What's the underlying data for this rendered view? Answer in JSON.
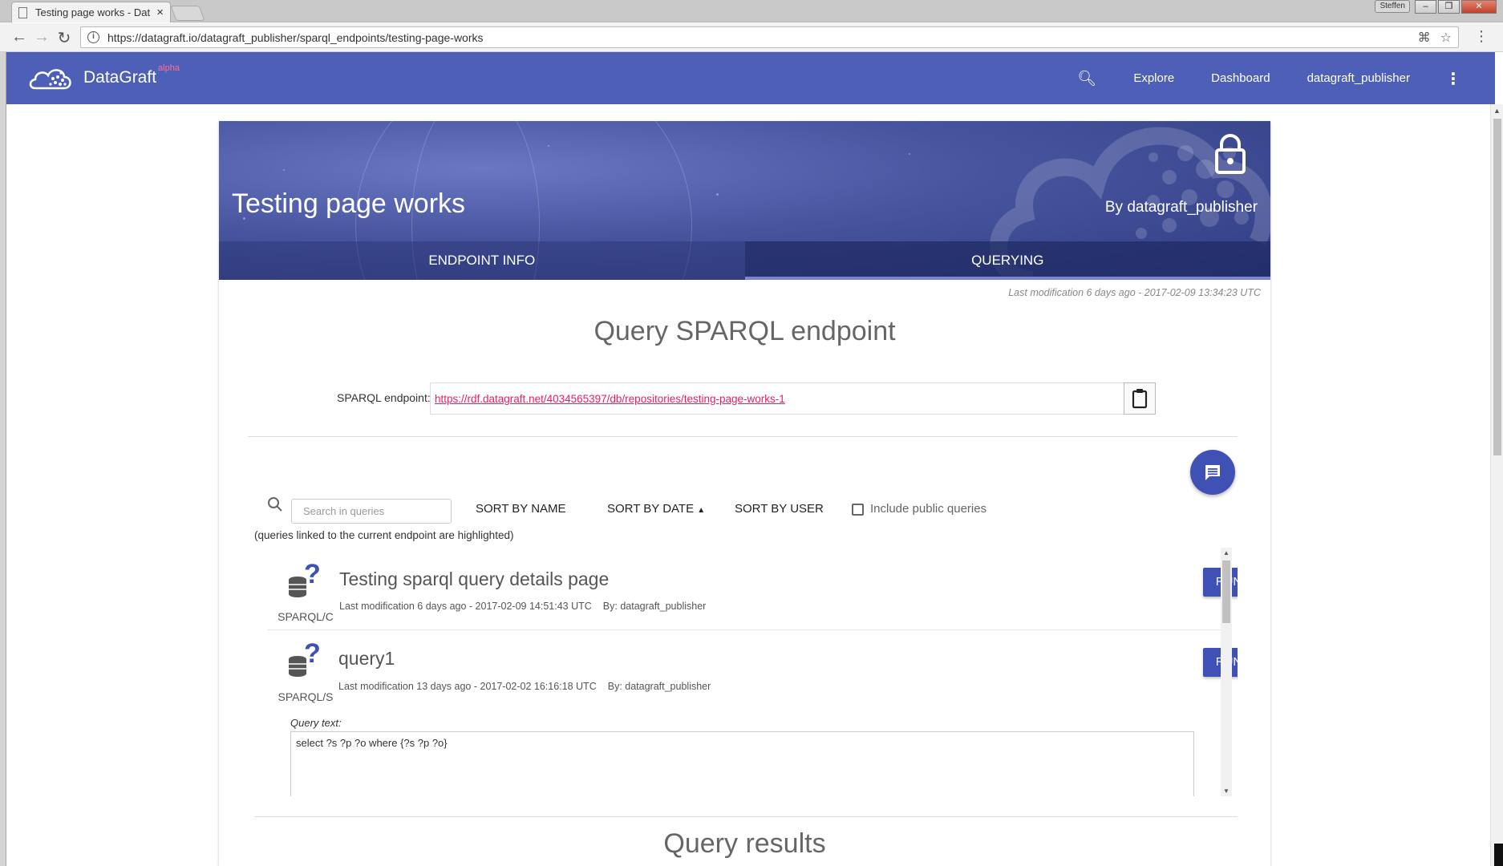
{
  "browser": {
    "tab_title": "Testing page works - Dat",
    "tab_close": "×",
    "user_badge": "Steffen",
    "url": "https://datagraft.io/datagraft_publisher/sparql_endpoints/testing-page-works"
  },
  "app": {
    "brand": "DataGraft",
    "brand_tag": "alpha",
    "nav": {
      "explore": "Explore",
      "dashboard": "Dashboard",
      "user": "datagraft_publisher"
    }
  },
  "endpoint": {
    "title": "Testing page works",
    "by": "By datagraft_publisher",
    "tabs": [
      {
        "label": "ENDPOINT INFO"
      },
      {
        "label": "QUERYING"
      }
    ],
    "last_modification": "Last modification 6 days ago - 2017-02-09 13:34:23 UTC"
  },
  "querying": {
    "heading": "Query SPARQL endpoint",
    "endpoint_label": "SPARQL endpoint:",
    "endpoint_url": "https://rdf.datagraft.net/4034565397/db/repositories/testing-page-works-1",
    "search_placeholder": "Search in queries",
    "sort_by_name": "SORT BY NAME",
    "sort_by_date": "SORT BY DATE",
    "sort_by_user": "SORT BY USER",
    "include_public": "Include public queries",
    "hint": "(queries linked to the current endpoint are highlighted)",
    "queries": [
      {
        "type": "SPARQL/C",
        "name": "Testing sparql query details page",
        "modified": "Last modification 6 days ago - 2017-02-09 14:51:43 UTC",
        "by": "By: datagraft_publisher",
        "run": "RUN"
      },
      {
        "type": "SPARQL/S",
        "name": "query1",
        "modified": "Last modification 13 days ago - 2017-02-02 16:16:18 UTC",
        "by": "By: datagraft_publisher",
        "run": "RUN",
        "query_text_label": "Query text:",
        "query_text": "select ?s ?p ?o where {?s ?p ?o}"
      }
    ],
    "results_heading": "Query results"
  },
  "colors": {
    "primary": "#3f51b5",
    "appbar": "#4e5fb8",
    "link": "#e91e63",
    "alpha": "#ff6f91"
  }
}
